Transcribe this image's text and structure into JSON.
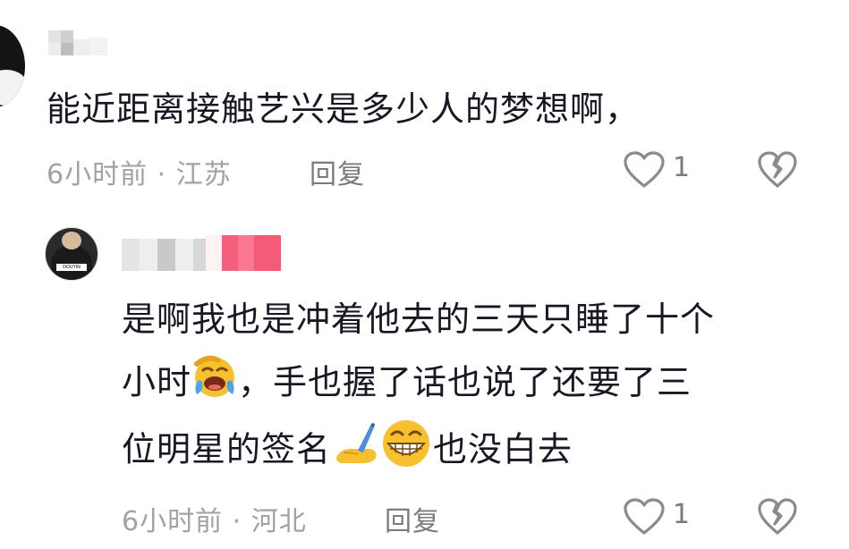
{
  "comments": [
    {
      "username": "",
      "text": "能近距离接触艺兴是多少人的梦想啊，",
      "time": "6小时前 · 江苏",
      "reply_label": "回复",
      "like_count": "1"
    }
  ],
  "reply": {
    "username": "",
    "avatar_logo": "DOUYIN",
    "text_line1": "是啊我也是冲着他去的三天只睡了十个",
    "text_line2a": "小时",
    "text_line2b": "，手也握了话也说了还要了三",
    "text_line3a": "位明星的签名",
    "text_line3b": "也没白去",
    "time": "6小时前 · 河北",
    "reply_label": "回复",
    "like_count": "1"
  },
  "icons": {
    "like": "heart-outline-icon",
    "dislike": "broken-heart-icon",
    "emoji1": "laughing-crying-face",
    "emoji2": "writing-hand",
    "emoji3": "grinning-face"
  }
}
